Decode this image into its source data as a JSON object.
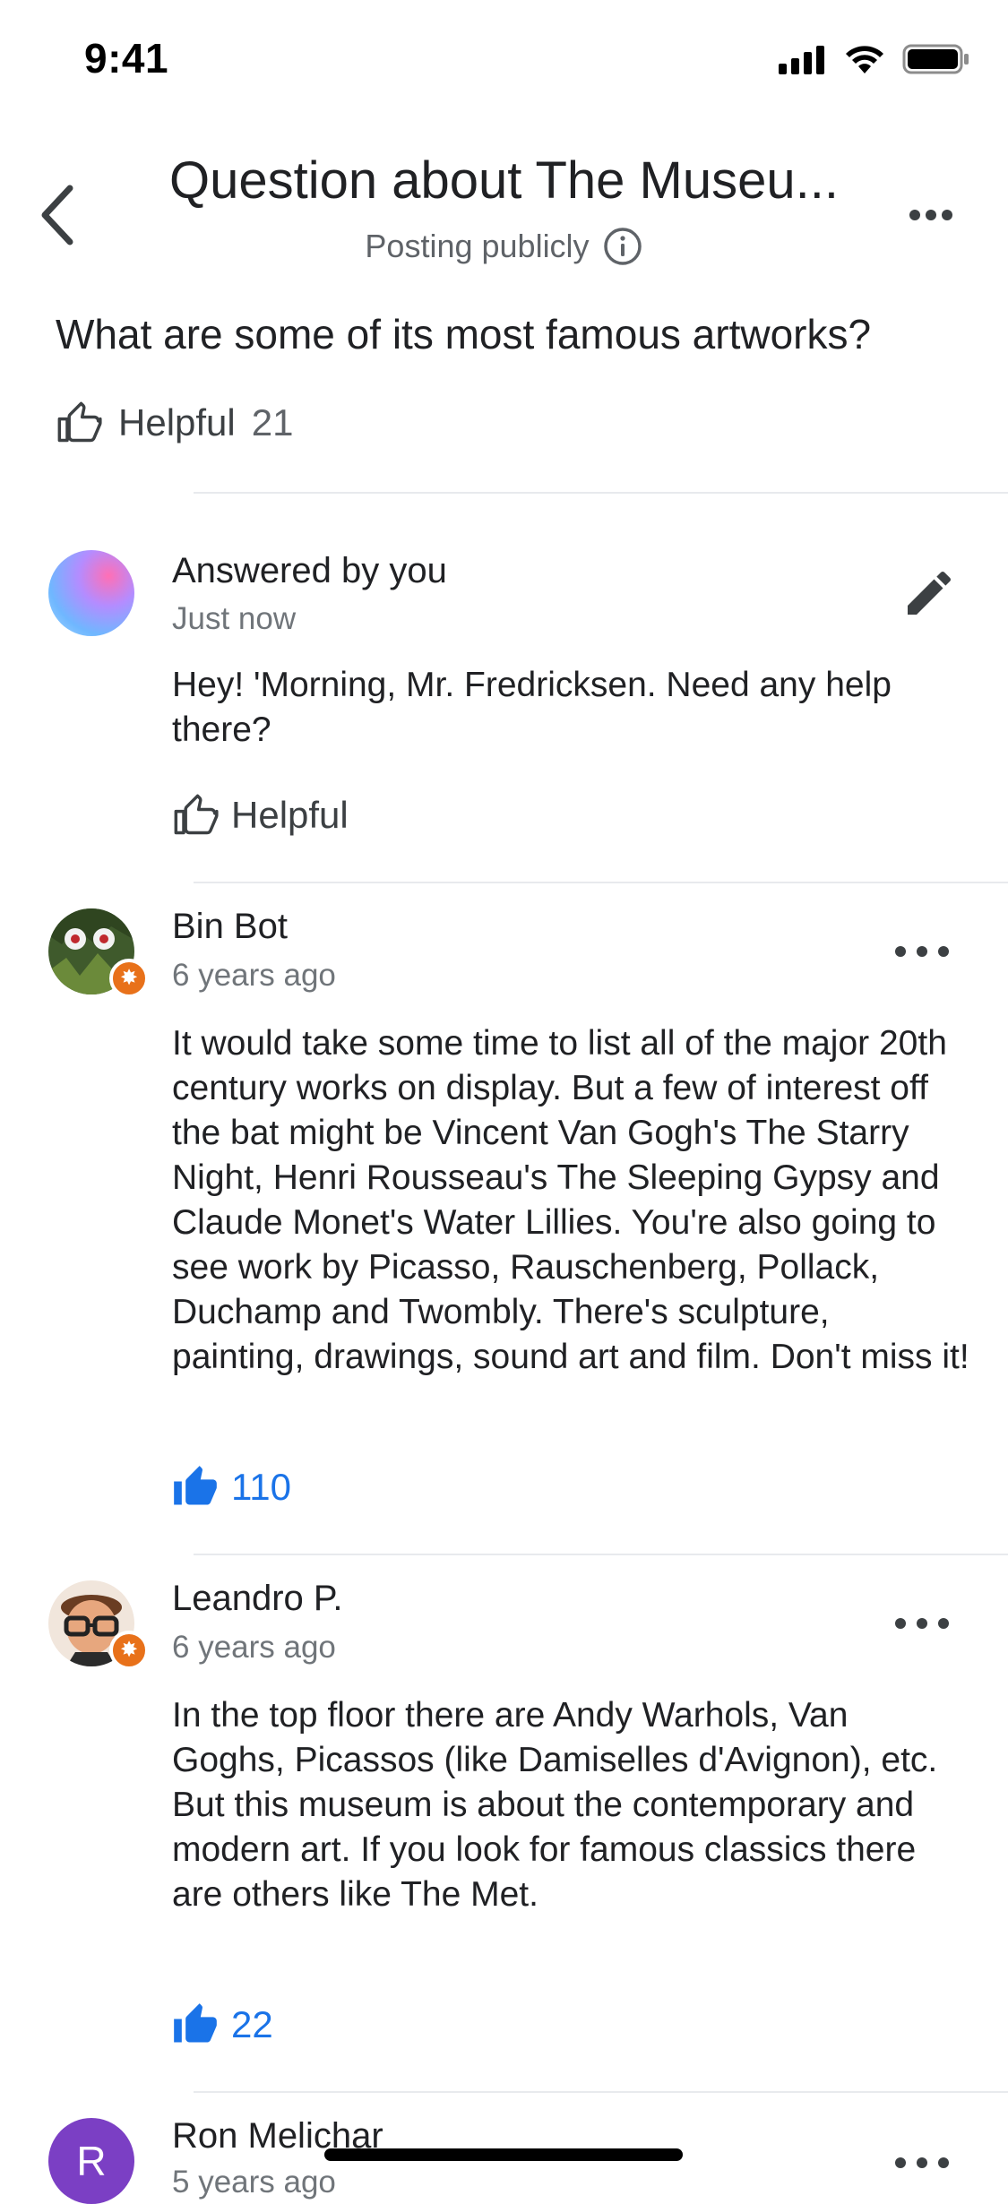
{
  "status_bar": {
    "time": "9:41"
  },
  "header": {
    "title": "Question about The Museu...",
    "subtitle": "Posting publicly"
  },
  "question": {
    "text": "What are some of its most famous artworks?",
    "helpful_label": "Helpful",
    "helpful_count": "21"
  },
  "my_answer": {
    "author": "Answered by you",
    "time": "Just now",
    "text": "Hey! 'Morning, Mr. Fredricksen. Need any help there?",
    "helpful_label": "Helpful"
  },
  "answers": [
    {
      "author": "Bin Bot",
      "time": "6 years ago",
      "text": "It would take some time to list all of the major 20th century works on display. But a few of interest off the bat might be Vincent Van Gogh's The Starry Night,  Henri Rousseau's The Sleeping Gypsy and Claude Monet's Water Lillies. You're also going to see work by Picasso, Rauschenberg, Pollack, Duchamp and Twombly. There's sculpture, painting, drawings, sound art and film. Don't miss it!",
      "votes": "110"
    },
    {
      "author": "Leandro P.",
      "time": "6 years ago",
      "text": "In the top floor there are Andy Warhols, Van Goghs, Picassos (like Damiselles d'Avignon), etc. But this museum is about the contemporary and modern art. If you look for famous classics there are others like The Met.",
      "votes": "22"
    },
    {
      "author": "Ron Melichar",
      "time": "5 years ago",
      "avatar_letter": "R"
    }
  ],
  "colors": {
    "accent_blue": "#1a73e8",
    "badge_orange": "#e8711a",
    "avatar_purple": "#7b3fc4"
  }
}
